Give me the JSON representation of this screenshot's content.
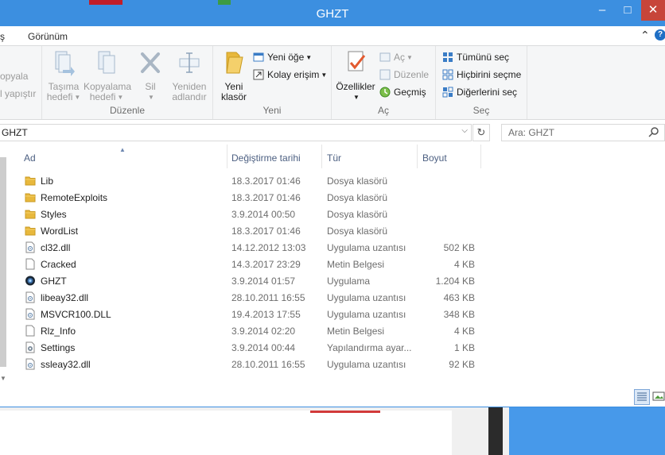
{
  "window": {
    "title": "GHZT"
  },
  "tabs": [
    {
      "label": "ş"
    },
    {
      "label": "Görünüm"
    }
  ],
  "ribbon": {
    "clipboard_partial": [
      "opyala",
      "l yapıştır"
    ],
    "organize": {
      "move_to": "Taşıma\nhedefi",
      "move_to_l1": "Taşıma",
      "move_to_l2": "hedefi",
      "copy_to_l1": "Kopyalama",
      "copy_to_l2": "hedefi",
      "delete_l1": "Sil",
      "rename_l1": "Yeniden",
      "rename_l2": "adlandır",
      "group_label": "Düzenle"
    },
    "new": {
      "new_folder_l1": "Yeni",
      "new_folder_l2": "klasör",
      "new_item": "Yeni öğe",
      "easy_access": "Kolay erişim",
      "group_label": "Yeni"
    },
    "open": {
      "properties": "Özellikler",
      "open": "Aç",
      "edit": "Düzenle",
      "history": "Geçmiş",
      "group_label": "Aç"
    },
    "select": {
      "select_all": "Tümünü seç",
      "select_none": "Hiçbirini seçme",
      "invert": "Diğerlerini seç",
      "group_label": "Seç"
    }
  },
  "address": {
    "path": "GHZT"
  },
  "search": {
    "placeholder": "Ara: GHZT"
  },
  "columns": {
    "name": "Ad",
    "date": "Değiştirme tarihi",
    "type": "Tür",
    "size": "Boyut"
  },
  "files": [
    {
      "name": "Lib",
      "date": "18.3.2017 01:46",
      "type": "Dosya klasörü",
      "size": "",
      "icon": "folder-icon"
    },
    {
      "name": "RemoteExploits",
      "date": "18.3.2017 01:46",
      "type": "Dosya klasörü",
      "size": "",
      "icon": "folder-icon"
    },
    {
      "name": "Styles",
      "date": "3.9.2014 00:50",
      "type": "Dosya klasörü",
      "size": "",
      "icon": "folder-icon"
    },
    {
      "name": "WordList",
      "date": "18.3.2017 01:46",
      "type": "Dosya klasörü",
      "size": "",
      "icon": "folder-icon"
    },
    {
      "name": "cl32.dll",
      "date": "14.12.2012 13:03",
      "type": "Uygulama uzantısı",
      "size": "502 KB",
      "icon": "dll-icon"
    },
    {
      "name": "Cracked",
      "date": "14.3.2017 23:29",
      "type": "Metin Belgesi",
      "size": "4 KB",
      "icon": "text-file-icon"
    },
    {
      "name": "GHZT",
      "date": "3.9.2014 01:57",
      "type": "Uygulama",
      "size": "1.204 KB",
      "icon": "app-icon"
    },
    {
      "name": "libeay32.dll",
      "date": "28.10.2011 16:55",
      "type": "Uygulama uzantısı",
      "size": "463 KB",
      "icon": "dll-icon"
    },
    {
      "name": "MSVCR100.DLL",
      "date": "19.4.2013 17:55",
      "type": "Uygulama uzantısı",
      "size": "348 KB",
      "icon": "dll-icon"
    },
    {
      "name": "Rlz_Info",
      "date": "3.9.2014 02:20",
      "type": "Metin Belgesi",
      "size": "4 KB",
      "icon": "text-file-icon"
    },
    {
      "name": "Settings",
      "date": "3.9.2014 00:44",
      "type": "Yapılandırma ayar...",
      "size": "1 KB",
      "icon": "settings-file-icon"
    },
    {
      "name": "ssleay32.dll",
      "date": "28.10.2011 16:55",
      "type": "Uygulama uzantısı",
      "size": "92 KB",
      "icon": "dll-icon"
    }
  ],
  "colors": {
    "titlebar": "#3c8fe0",
    "folder": "#e8b83c",
    "accent": "#1f6fc5"
  }
}
